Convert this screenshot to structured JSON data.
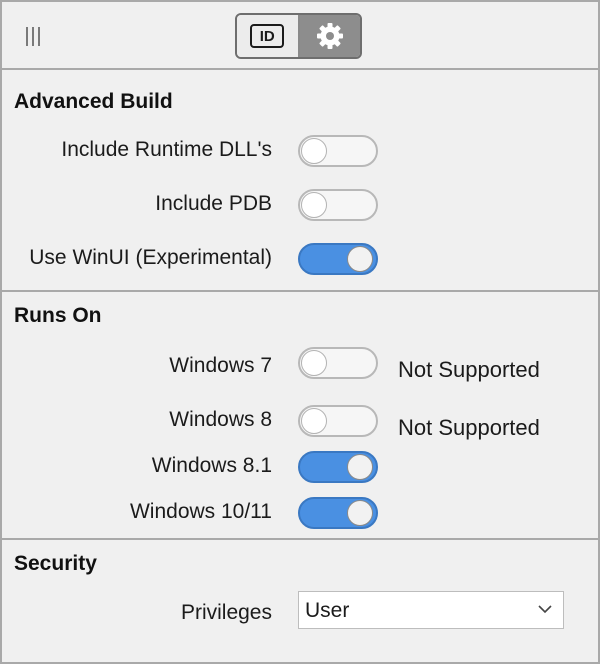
{
  "toolbar": {
    "grip_icon": "grip-lines-icon",
    "id_button_text": "ID",
    "settings_icon": "gear-icon"
  },
  "advanced_build": {
    "title": "Advanced Build",
    "items": [
      {
        "label": "Include Runtime DLL's",
        "on": false
      },
      {
        "label": "Include PDB",
        "on": false
      },
      {
        "label": "Use WinUI (Experimental)",
        "on": true
      }
    ]
  },
  "runs_on": {
    "title": "Runs On",
    "items": [
      {
        "label": "Windows 7",
        "on": false,
        "note": "Not Supported"
      },
      {
        "label": "Windows 8",
        "on": false,
        "note": "Not Supported"
      },
      {
        "label": "Windows 8.1",
        "on": true,
        "note": ""
      },
      {
        "label": "Windows 10/11",
        "on": true,
        "note": ""
      }
    ]
  },
  "security": {
    "title": "Security",
    "privileges_label": "Privileges",
    "privileges_value": "User"
  },
  "colors": {
    "toggle_on": "#4a90e2",
    "panel_bg": "#f0f0f0",
    "border": "#a9a9a9"
  }
}
